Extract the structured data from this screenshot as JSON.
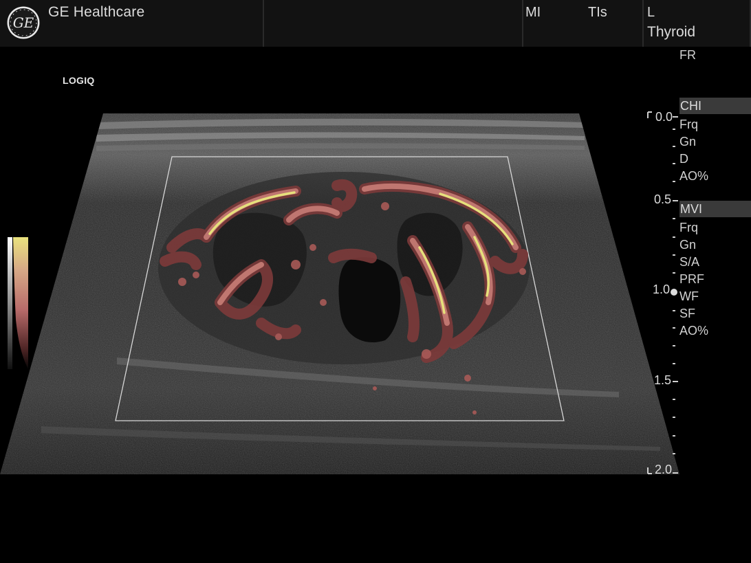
{
  "header": {
    "brand_name": "GE Healthcare",
    "logo_text": "GE",
    "mi_label": "MI",
    "tis_label": "TIs",
    "probe_side": "L",
    "preset": "Thyroid"
  },
  "system_label": "LOGIQ",
  "frame_rate_label": "FR",
  "chi_panel": {
    "title": "CHI",
    "items": [
      "Frq",
      "Gn",
      "D",
      "AO%"
    ]
  },
  "mvi_panel": {
    "title": "MVI",
    "items": [
      "Frq",
      "Gn",
      "S/A",
      "PRF",
      "WF",
      "SF",
      "AO%"
    ]
  },
  "depth_scale": {
    "unit_labels": [
      "0.0",
      "0.5",
      "1.0",
      "1.5",
      "2.0"
    ]
  },
  "colors": {
    "background": "#000000",
    "header_bg": "#121212",
    "panel_header_bg": "#3a3a3a",
    "flow_low": "#7a3a38",
    "flow_mid": "#c9787a",
    "flow_high": "#e6e27a"
  },
  "icons": {
    "logo": "ge-monogram-icon",
    "focus_marker": "focus-dot-icon",
    "colorbar": "mvi-color-scale"
  }
}
